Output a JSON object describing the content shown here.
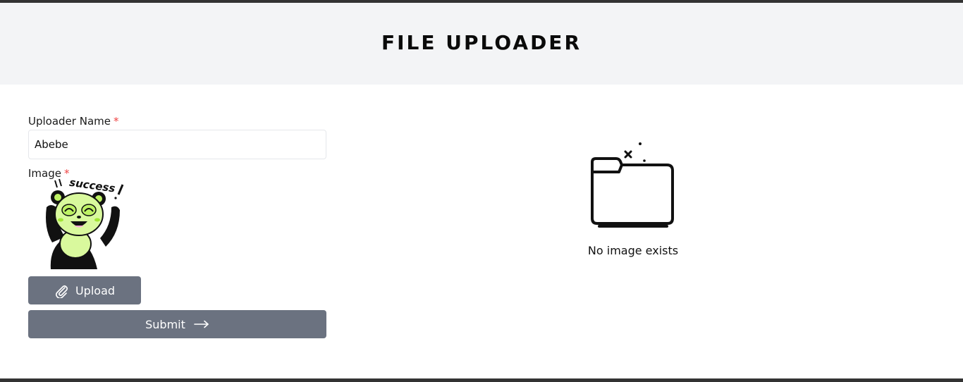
{
  "header": {
    "title": "FILE UPLOADER"
  },
  "form": {
    "name_label": "Uploader Name",
    "required_mark": "*",
    "name_value": "Abebe",
    "image_label": "Image",
    "preview_caption": "success",
    "upload_label": "Upload",
    "submit_label": "Submit"
  },
  "gallery": {
    "empty_text": "No image exists"
  },
  "colors": {
    "header_bg": "#f3f4f6",
    "button_bg": "#6b7280",
    "required": "#ef4444",
    "mascot_green": "#d9f99d"
  },
  "icons": {
    "upload": "paperclip-icon",
    "submit": "arrow-right-icon",
    "empty": "empty-folder-icon"
  }
}
